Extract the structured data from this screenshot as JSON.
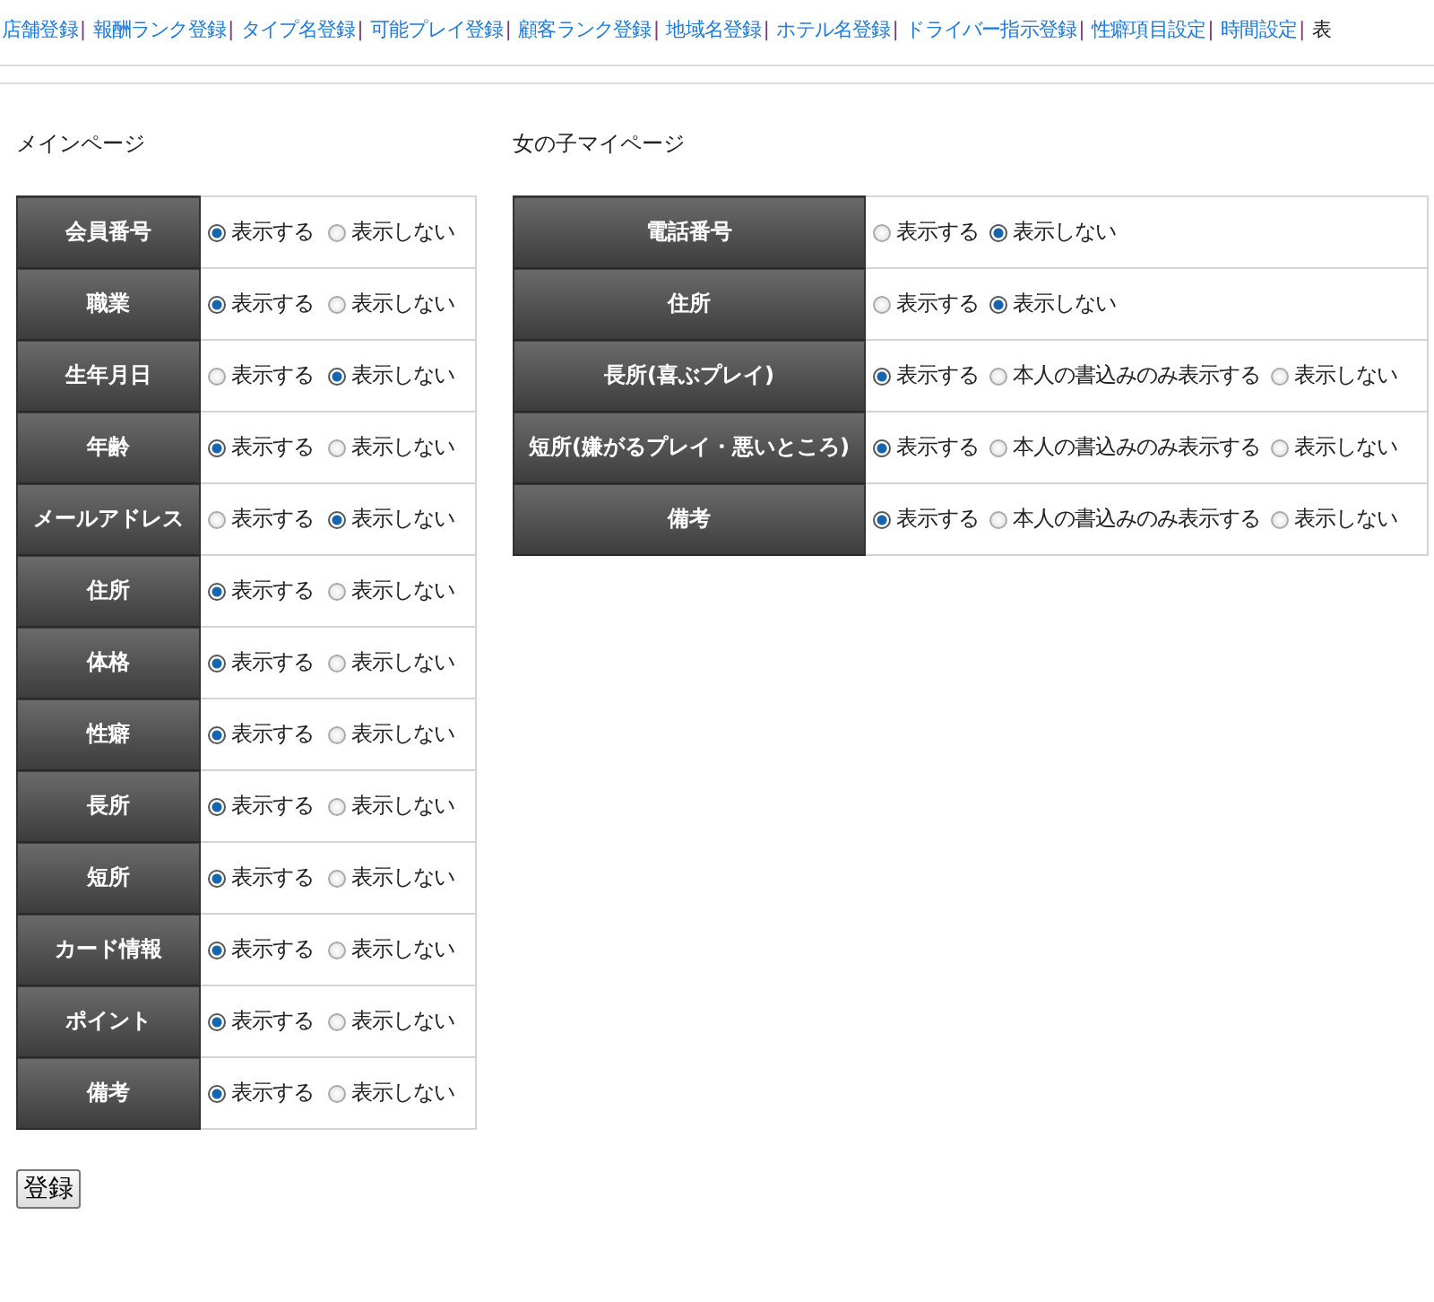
{
  "nav": [
    {
      "label": "店舗登録",
      "selected": false
    },
    {
      "label": "報酬ランク登録",
      "selected": false
    },
    {
      "label": "タイプ名登録",
      "selected": false
    },
    {
      "label": "可能プレイ登録",
      "selected": false
    },
    {
      "label": "顧客ランク登録",
      "selected": false
    },
    {
      "label": "地域名登録",
      "selected": false
    },
    {
      "label": "ホテル名登録",
      "selected": false
    },
    {
      "label": "ドライバー指示登録",
      "selected": false
    },
    {
      "label": "性癖項目設定",
      "selected": false
    },
    {
      "label": "時間設定",
      "selected": false
    },
    {
      "label": "表",
      "selected": true
    }
  ],
  "sections": [
    {
      "title": "メインページ",
      "rows": [
        {
          "label": "会員番号",
          "options": [
            {
              "label": "表示する",
              "selected": true
            },
            {
              "label": "表示しない",
              "selected": false
            }
          ]
        },
        {
          "label": "職業",
          "options": [
            {
              "label": "表示する",
              "selected": true
            },
            {
              "label": "表示しない",
              "selected": false
            }
          ]
        },
        {
          "label": "生年月日",
          "options": [
            {
              "label": "表示する",
              "selected": false
            },
            {
              "label": "表示しない",
              "selected": true
            }
          ]
        },
        {
          "label": "年齢",
          "options": [
            {
              "label": "表示する",
              "selected": true
            },
            {
              "label": "表示しない",
              "selected": false
            }
          ]
        },
        {
          "label": "メールアドレス",
          "options": [
            {
              "label": "表示する",
              "selected": false
            },
            {
              "label": "表示しない",
              "selected": true
            }
          ]
        },
        {
          "label": "住所",
          "options": [
            {
              "label": "表示する",
              "selected": true
            },
            {
              "label": "表示しない",
              "selected": false
            }
          ]
        },
        {
          "label": "体格",
          "options": [
            {
              "label": "表示する",
              "selected": true
            },
            {
              "label": "表示しない",
              "selected": false
            }
          ]
        },
        {
          "label": "性癖",
          "options": [
            {
              "label": "表示する",
              "selected": true
            },
            {
              "label": "表示しない",
              "selected": false
            }
          ]
        },
        {
          "label": "長所",
          "options": [
            {
              "label": "表示する",
              "selected": true
            },
            {
              "label": "表示しない",
              "selected": false
            }
          ]
        },
        {
          "label": "短所",
          "options": [
            {
              "label": "表示する",
              "selected": true
            },
            {
              "label": "表示しない",
              "selected": false
            }
          ]
        },
        {
          "label": "カード情報",
          "options": [
            {
              "label": "表示する",
              "selected": true
            },
            {
              "label": "表示しない",
              "selected": false
            }
          ]
        },
        {
          "label": "ポイント",
          "options": [
            {
              "label": "表示する",
              "selected": true
            },
            {
              "label": "表示しない",
              "selected": false
            }
          ]
        },
        {
          "label": "備考",
          "options": [
            {
              "label": "表示する",
              "selected": true
            },
            {
              "label": "表示しない",
              "selected": false
            }
          ]
        }
      ]
    },
    {
      "title": "女の子マイページ",
      "rows": [
        {
          "label": "電話番号",
          "options": [
            {
              "label": "表示する",
              "selected": false
            },
            {
              "label": "表示しない",
              "selected": true
            }
          ]
        },
        {
          "label": "住所",
          "options": [
            {
              "label": "表示する",
              "selected": false
            },
            {
              "label": "表示しない",
              "selected": true
            }
          ]
        },
        {
          "label": "長所(喜ぶプレイ)",
          "options": [
            {
              "label": "表示する",
              "selected": true
            },
            {
              "label": "本人の書込みのみ表示する",
              "selected": false
            },
            {
              "label": "表示しない",
              "selected": false
            }
          ]
        },
        {
          "label": "短所(嫌がるプレイ・悪いところ)",
          "options": [
            {
              "label": "表示する",
              "selected": true
            },
            {
              "label": "本人の書込みのみ表示する",
              "selected": false
            },
            {
              "label": "表示しない",
              "selected": false
            }
          ]
        },
        {
          "label": "備考",
          "options": [
            {
              "label": "表示する",
              "selected": true
            },
            {
              "label": "本人の書込みのみ表示する",
              "selected": false
            },
            {
              "label": "表示しない",
              "selected": false
            }
          ]
        }
      ]
    }
  ],
  "nav_separator": "|",
  "submit": "登録"
}
